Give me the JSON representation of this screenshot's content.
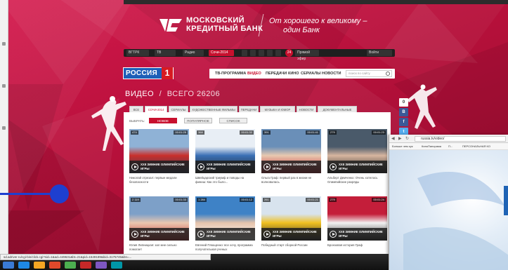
{
  "bank": {
    "name_line1": "МОСКОВСКИЙ",
    "name_line2": "КРЕДИТНЫЙ БАНК",
    "tagline_line1": "От хорошего к великому –",
    "tagline_line2": "один Банк"
  },
  "navbar": {
    "items": [
      "ВГТРК",
      "ТВ",
      "Радио",
      "Сочи-2014",
      "",
      "",
      "",
      "",
      "",
      "Прямой эфир",
      "Войти"
    ]
  },
  "site": {
    "logo_text": "РОССИЯ",
    "logo_number": "1",
    "menu": [
      "ТВ-ПРОГРАММА",
      "ВИДЕО",
      "ПЕРЕДАЧИ",
      "КИНО",
      "СЕРИАЛЫ",
      "НОВОСТИ"
    ],
    "search_placeholder": "поиск по сайту"
  },
  "heading": {
    "title": "ВИДЕО",
    "separator": "/",
    "count": "ВСЕГО 26206"
  },
  "tabs": [
    "ВСЕ",
    "СОЧИ-2014",
    "СЕРИАЛЫ",
    "ХУДОЖЕСТВЕННЫЕ ФИЛЬМЫ",
    "ПЕРЕДАЧИ",
    "МУЗЫКА И ЮМОР",
    "НОВОСТИ",
    "ДОКУМЕНТАЛЬНЫЕ"
  ],
  "filters": {
    "label": "ВЫБРАТЬ:",
    "options": [
      "НОВОЕ",
      "ПОПУЛЯРНОЕ",
      "СПИСОК"
    ]
  },
  "videos": [
    {
      "badge": "474",
      "time": "00:01:25",
      "title": "XXII ЗИМНИЕ ОЛИМПИЙСКИЕ ИГРЫ",
      "caption": "Николай отрезал: первые медали безопасности",
      "colors": [
        "#8fb2d6",
        "#c9302c",
        "#2a3a5a"
      ]
    },
    {
      "badge": "368",
      "time": "00:01:32",
      "title": "XXII ЗИМНИЕ ОЛИМПИЙСКИЕ ИГРЫ",
      "caption": "Швейцарский триумф и поводы на финиш: Как это было...",
      "colors": [
        "#e8eef5",
        "#3a6fb5",
        "#222"
      ]
    },
    {
      "badge": "391",
      "time": "00:01:41",
      "title": "XXII ЗИМНИЕ ОЛИМПИЙСКИЕ ИГРЫ",
      "caption": "Ольга Граф: первый раз в жизни не волновалась",
      "colors": [
        "#6a8fb8",
        "#e8c9b0",
        "#c21e2a"
      ]
    },
    {
      "badge": "279",
      "time": "00:01:23",
      "title": "XXII ЗИМНИЕ ОЛИМПИЙСКИЕ ИГРЫ",
      "caption": "Альберт Демченко: Очень хотелось Олимпийские разряды",
      "colors": [
        "#4a5a6a",
        "#d8b6a0",
        "#1a1a1a"
      ]
    },
    {
      "badge": "2 119",
      "time": "00:01:33",
      "title": "XXII ЗИМНИЕ ОЛИМПИЙСКИЕ ИГРЫ",
      "caption": "Юлия Липницкая: зал мне сильно помогает",
      "colors": [
        "#7da0c8",
        "#eac7b0",
        "#c93030"
      ]
    },
    {
      "badge": "1 284",
      "time": "00:01:12",
      "title": "XXII ЗИМНИЕ ОЛИМПИЙСКИЕ ИГРЫ",
      "caption": "Евгений Плющенко: все хочу, программа получательная ученых",
      "colors": [
        "#3e82c6",
        "#e5c4ac",
        "#ffffff"
      ]
    },
    {
      "badge": "261",
      "time": "00:01:21",
      "title": "XXII ЗИМНИЕ ОЛИМПИЙСКИЕ ИГРЫ",
      "caption": "Победный старт сборной России",
      "colors": [
        "#d8e3ee",
        "#f0c020",
        "#2a2a2a"
      ]
    },
    {
      "badge": "279",
      "time": "00:01:24",
      "title": "XXII ЗИМНИЕ ОЛИМПИЙСКИЕ ИГРЫ",
      "caption": "Бронзовая история Граф",
      "colors": [
        "#c41e3a",
        "#f2f2f2",
        "#2a2a2a"
      ]
    }
  ],
  "share": [
    "0",
    "В",
    "f",
    "t"
  ],
  "browser": {
    "url": "russia.tv/video/",
    "bookmarks": [
      "Больше чем кук",
      "КиноПанорама",
      "П...",
      "ПЕРСОНАЛЬНАЯ КО"
    ]
  },
  "status_bar": "sd.adriver.ru/cgi-bin/click.cgi?sid=1&ad=449631&bt=21&pid=1549189&bid=3175745&bn=..."
}
